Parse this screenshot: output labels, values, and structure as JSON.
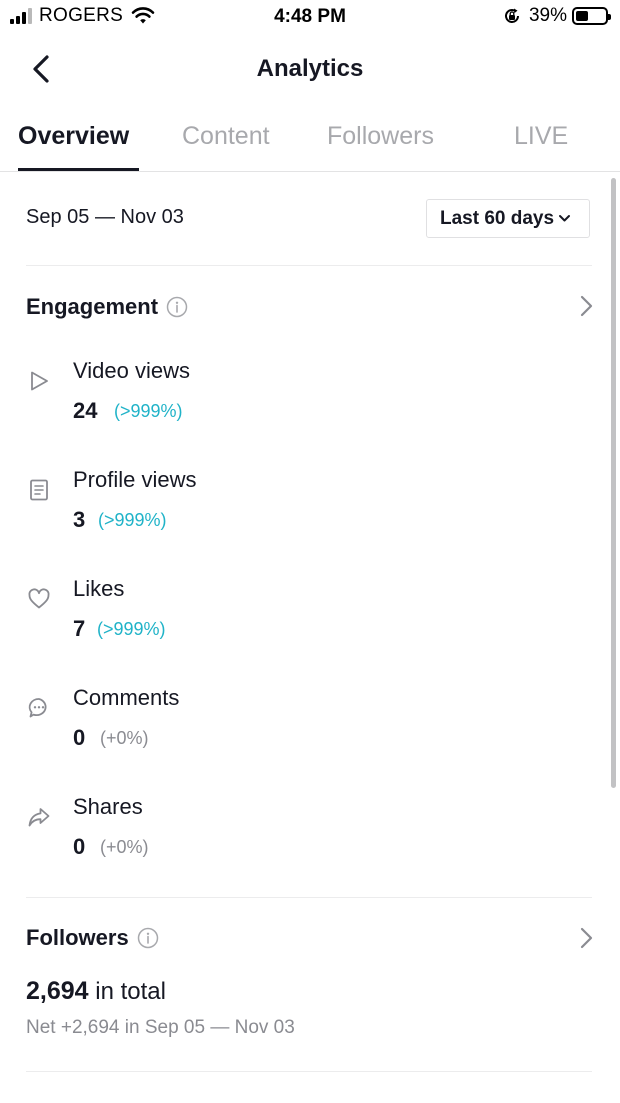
{
  "status_bar": {
    "carrier": "ROGERS",
    "time": "4:48 PM",
    "battery": "39%",
    "battery_level": 0.39,
    "icons": [
      "signal-icon",
      "wifi-icon",
      "rotation-lock-icon",
      "battery-icon"
    ]
  },
  "header": {
    "title": "Analytics",
    "back_icon": "chevron-left-icon"
  },
  "tabs": [
    {
      "label": "Overview",
      "active": true
    },
    {
      "label": "Content",
      "active": false
    },
    {
      "label": "Followers",
      "active": false
    },
    {
      "label": "LIVE",
      "active": false
    }
  ],
  "date_range": "Sep 05 — Nov 03",
  "period_select": {
    "value": "Last 60 days",
    "icon": "chevron-down-icon"
  },
  "engagement": {
    "title": "Engagement",
    "metrics": [
      {
        "label": "Video views",
        "value": "24",
        "change": "(>999%)",
        "icon": "play-outline-icon"
      },
      {
        "label": "Profile views",
        "value": "3",
        "change": "(>999%)",
        "icon": "document-icon"
      },
      {
        "label": "Likes",
        "value": "7",
        "change": "(>999%)",
        "icon": "heart-outline-icon"
      },
      {
        "label": "Comments",
        "value": "0",
        "change": "(+0%)",
        "icon": "comment-icon"
      },
      {
        "label": "Shares",
        "value": "0",
        "change": "(+0%)",
        "icon": "share-arrow-icon"
      }
    ]
  },
  "followers": {
    "title": "Followers",
    "total_value": "2,694",
    "total_suffix": " in total",
    "net": "Net +2,694 in Sep 05 — Nov 03"
  },
  "colors": {
    "text": "#161823",
    "muted": "#a8a9ad",
    "accent": "#20b3c8",
    "change_neutral": "#8a8b91"
  }
}
